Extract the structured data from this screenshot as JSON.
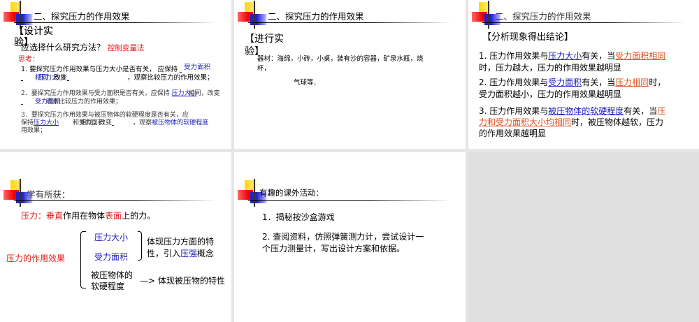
{
  "slides": [
    {
      "title": "二、探究压力的作用效果",
      "heading": "【设计实验】",
      "heading_l1": "【设计实",
      "heading_l2": "验】",
      "question": "应选择什么研究方法？",
      "answer": "控制变量法",
      "think": "思考：",
      "q1a": "1. 要探究压力作用效果与压力大小是否有关，  应保持",
      "q1_blank1": "受力面积",
      "q1_blank2": "相同",
      "q1_blank3": "压力大小",
      "q1b": "改变",
      "q1c": "，观察比较压力的作用效果；",
      "q2a": "2．要探究压力作用效果与受力面积是否有关，应保持",
      "q2_blank1": "压力大小",
      "q2b": "相同，改变",
      "q2_blank2": "受力面积",
      "q2c": "观察比较压力的作用效果；",
      "q3a": "3．要探究压力作用效果与被压物体的软硬程度是否有关，应",
      "q3b": "保持",
      "q3_blank1": "压力大小",
      "q3c": "和受力面积",
      "q3d": "相同，改变",
      "q3e": "，观察",
      "q3_blank2": "被压物体的软硬程度",
      "q3f": "用效果；"
    },
    {
      "title": "二、探究压力的作用效果",
      "heading_l1": "【进行实",
      "heading_l2": "验】",
      "materials_l1": "器材：海绵，小砖，小桌，装有沙的容器，矿泉水瓶，烧",
      "materials_l2": "杯，",
      "materials_l3": "气球等．"
    },
    {
      "title": "二、探究压力的作用效果",
      "heading": "【分析现象得出结论】",
      "c1": [
        "1. 压力作用效果与",
        "压力大小",
        "有关，当",
        "受力面积相同",
        "时，压力越大，压力的作用效果越明显"
      ],
      "c2": [
        "2. 压力作用效果与",
        "受力面积",
        "有关，当",
        "压力相同",
        "时，",
        "受力面积越小，压力的作用效果越明显"
      ],
      "c3": [
        "3. 压力作用效果与",
        "被压物体的软硬程度",
        "有关，当",
        "压",
        "力和受力面积大小均相同",
        "时，被压物体越软，压力",
        "的作用效果越明显"
      ]
    },
    {
      "title": "学有所获：",
      "def": [
        "压力：",
        "垂直",
        "作用在物体",
        "表面",
        "上的力。"
      ],
      "root": "压力的作用效果",
      "branch1": "压力大小",
      "branch2": "受力面积",
      "note1_l1": "体现压力方面的特",
      "note1_l2a": "性，引入",
      "note1_l2b": "压强",
      "note1_l2c": "概念",
      "branch3_l1": "被压物体的",
      "branch3_l2": "软硬程度",
      "note2": "—> 体现被压物的特性"
    },
    {
      "title": "有趣的课外活动：",
      "item1": "1．揭秘按沙盒游戏",
      "item2_l1": "2. 查阅资料，仿照弹簧测力计，尝试设计一",
      "item2_l2": "个压力测量计，写出设计方案和依据。"
    }
  ]
}
